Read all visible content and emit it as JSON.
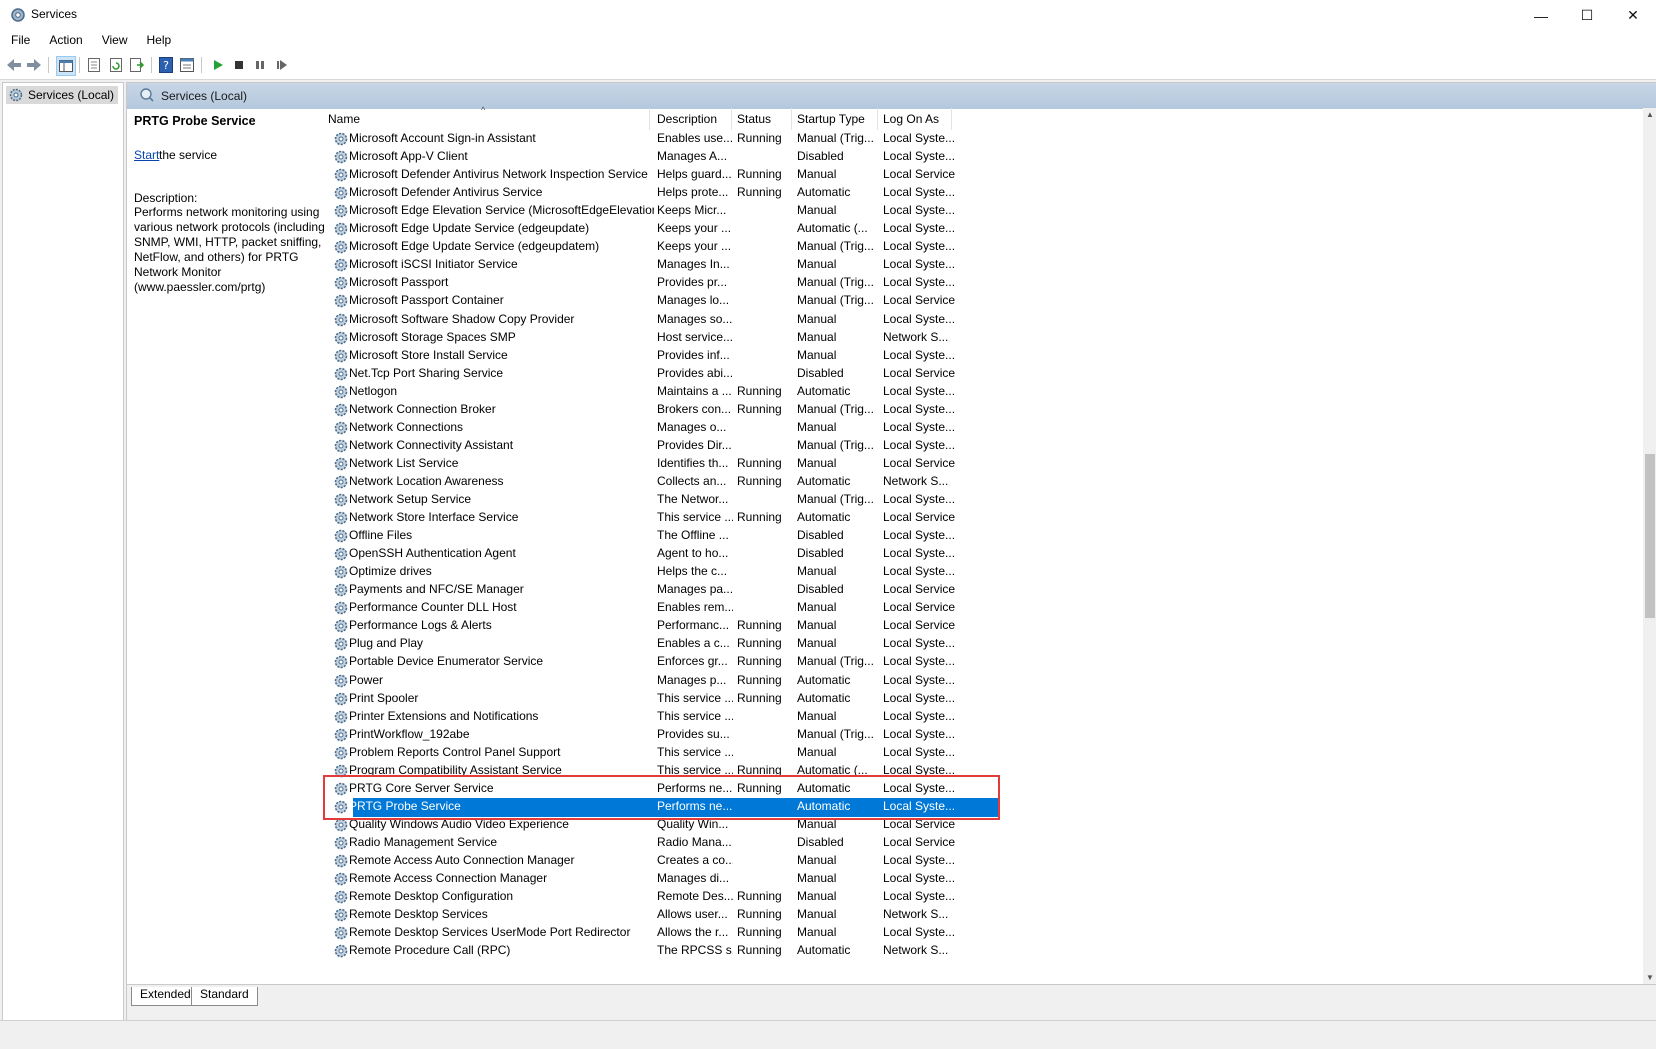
{
  "window": {
    "title": "Services",
    "min": "—",
    "max": "☐",
    "close": "✕"
  },
  "menu": [
    "File",
    "Action",
    "View",
    "Help"
  ],
  "tree": {
    "item": "Services (Local)"
  },
  "main": {
    "header": "Services (Local)",
    "selected_title": "PRTG Probe Service",
    "start_link": "Start",
    "start_rest": " the service",
    "desc_label": "Description:",
    "desc_body": "Performs network monitoring using various network protocols (including SNMP, WMI, HTTP, packet sniffing, NetFlow, and others) for PRTG Network Monitor (www.paessler.com/prtg)"
  },
  "columns": [
    "Name",
    "Description",
    "Status",
    "Startup Type",
    "Log On As"
  ],
  "sort_indicator": "^",
  "rows": [
    [
      "Microsoft Account Sign-in Assistant",
      "Enables use...",
      "Running",
      "Manual (Trig...",
      "Local Syste..."
    ],
    [
      "Microsoft App-V Client",
      "Manages A...",
      "",
      "Disabled",
      "Local Syste..."
    ],
    [
      "Microsoft Defender Antivirus Network Inspection Service",
      "Helps guard...",
      "Running",
      "Manual",
      "Local Service"
    ],
    [
      "Microsoft Defender Antivirus Service",
      "Helps prote...",
      "Running",
      "Automatic",
      "Local Syste..."
    ],
    [
      "Microsoft Edge Elevation Service (MicrosoftEdgeElevationS...",
      "Keeps Micr...",
      "",
      "Manual",
      "Local Syste..."
    ],
    [
      "Microsoft Edge Update Service (edgeupdate)",
      "Keeps your ...",
      "",
      "Automatic (...",
      "Local Syste..."
    ],
    [
      "Microsoft Edge Update Service (edgeupdatem)",
      "Keeps your ...",
      "",
      "Manual (Trig...",
      "Local Syste..."
    ],
    [
      "Microsoft iSCSI Initiator Service",
      "Manages In...",
      "",
      "Manual",
      "Local Syste..."
    ],
    [
      "Microsoft Passport",
      "Provides pr...",
      "",
      "Manual (Trig...",
      "Local Syste..."
    ],
    [
      "Microsoft Passport Container",
      "Manages lo...",
      "",
      "Manual (Trig...",
      "Local Service"
    ],
    [
      "Microsoft Software Shadow Copy Provider",
      "Manages so...",
      "",
      "Manual",
      "Local Syste..."
    ],
    [
      "Microsoft Storage Spaces SMP",
      "Host service...",
      "",
      "Manual",
      "Network S..."
    ],
    [
      "Microsoft Store Install Service",
      "Provides inf...",
      "",
      "Manual",
      "Local Syste..."
    ],
    [
      "Net.Tcp Port Sharing Service",
      "Provides abi...",
      "",
      "Disabled",
      "Local Service"
    ],
    [
      "Netlogon",
      "Maintains a ...",
      "Running",
      "Automatic",
      "Local Syste..."
    ],
    [
      "Network Connection Broker",
      "Brokers con...",
      "Running",
      "Manual (Trig...",
      "Local Syste..."
    ],
    [
      "Network Connections",
      "Manages o...",
      "",
      "Manual",
      "Local Syste..."
    ],
    [
      "Network Connectivity Assistant",
      "Provides Dir...",
      "",
      "Manual (Trig...",
      "Local Syste..."
    ],
    [
      "Network List Service",
      "Identifies th...",
      "Running",
      "Manual",
      "Local Service"
    ],
    [
      "Network Location Awareness",
      "Collects an...",
      "Running",
      "Automatic",
      "Network S..."
    ],
    [
      "Network Setup Service",
      "The Networ...",
      "",
      "Manual (Trig...",
      "Local Syste..."
    ],
    [
      "Network Store Interface Service",
      "This service ...",
      "Running",
      "Automatic",
      "Local Service"
    ],
    [
      "Offline Files",
      "The Offline ...",
      "",
      "Disabled",
      "Local Syste..."
    ],
    [
      "OpenSSH Authentication Agent",
      "Agent to ho...",
      "",
      "Disabled",
      "Local Syste..."
    ],
    [
      "Optimize drives",
      "Helps the c...",
      "",
      "Manual",
      "Local Syste..."
    ],
    [
      "Payments and NFC/SE Manager",
      "Manages pa...",
      "",
      "Disabled",
      "Local Service"
    ],
    [
      "Performance Counter DLL Host",
      "Enables rem...",
      "",
      "Manual",
      "Local Service"
    ],
    [
      "Performance Logs & Alerts",
      "Performanc...",
      "Running",
      "Manual",
      "Local Service"
    ],
    [
      "Plug and Play",
      "Enables a c...",
      "Running",
      "Manual",
      "Local Syste..."
    ],
    [
      "Portable Device Enumerator Service",
      "Enforces gr...",
      "Running",
      "Manual (Trig...",
      "Local Syste..."
    ],
    [
      "Power",
      "Manages p...",
      "Running",
      "Automatic",
      "Local Syste..."
    ],
    [
      "Print Spooler",
      "This service ...",
      "Running",
      "Automatic",
      "Local Syste..."
    ],
    [
      "Printer Extensions and Notifications",
      "This service ...",
      "",
      "Manual",
      "Local Syste..."
    ],
    [
      "PrintWorkflow_192abe",
      "Provides su...",
      "",
      "Manual (Trig...",
      "Local Syste..."
    ],
    [
      "Problem Reports Control Panel Support",
      "This service ...",
      "",
      "Manual",
      "Local Syste..."
    ],
    [
      "Program Compatibility Assistant Service",
      "This service ...",
      "Running",
      "Automatic (...",
      "Local Syste..."
    ],
    [
      "PRTG Core Server Service",
      "Performs ne...",
      "Running",
      "Automatic",
      "Local Syste..."
    ],
    [
      "PRTG Probe Service",
      "Performs ne...",
      "",
      "Automatic",
      "Local Syste..."
    ],
    [
      "Quality Windows Audio Video Experience",
      "Quality Win...",
      "",
      "Manual",
      "Local Service"
    ],
    [
      "Radio Management Service",
      "Radio Mana...",
      "",
      "Disabled",
      "Local Service"
    ],
    [
      "Remote Access Auto Connection Manager",
      "Creates a co...",
      "",
      "Manual",
      "Local Syste..."
    ],
    [
      "Remote Access Connection Manager",
      "Manages di...",
      "",
      "Manual",
      "Local Syste..."
    ],
    [
      "Remote Desktop Configuration",
      "Remote Des...",
      "Running",
      "Manual",
      "Local Syste..."
    ],
    [
      "Remote Desktop Services",
      "Allows user...",
      "Running",
      "Manual",
      "Network S..."
    ],
    [
      "Remote Desktop Services UserMode Port Redirector",
      "Allows the r...",
      "Running",
      "Manual",
      "Local Syste..."
    ],
    [
      "Remote Procedure Call (RPC)",
      "The RPCSS s...",
      "Running",
      "Automatic",
      "Network S..."
    ]
  ],
  "selected_index": 37,
  "tabs": [
    "Extended",
    "Standard"
  ],
  "colors": {
    "selection": "#0078d7",
    "highlight_box": "#e23b3b",
    "header_band": "#b4c8dd"
  }
}
